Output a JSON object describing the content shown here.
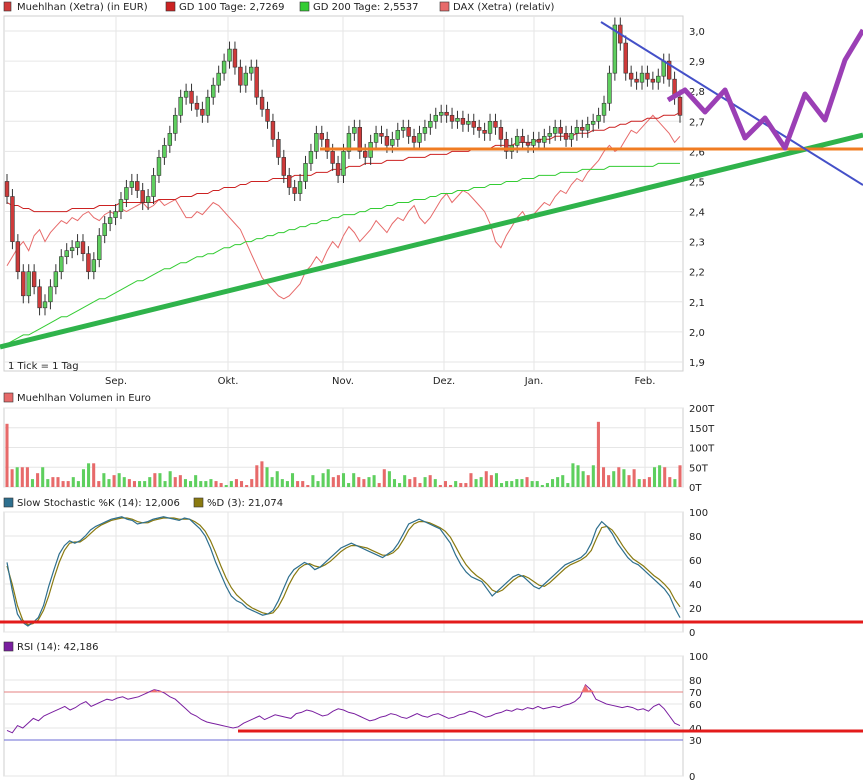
{
  "colors": {
    "up": "#5ecf5e",
    "down": "#cf3a3a",
    "gd100": "#cc2222",
    "gd200": "#33cc33",
    "dax": "#e76a6a",
    "stoch_k": "#2e6f8e",
    "stoch_d": "#8a7a10",
    "rsi": "#7a1fa0",
    "trend_green": "#2fb34b",
    "trend_blue": "#4450c8",
    "support_orange": "#f07c22",
    "purple_path": "#9b3fb5",
    "red_line": "#e31b1b",
    "grid": "#e6e6e6"
  },
  "chart_data": [
    {
      "type": "candlestick",
      "panel": "price",
      "legend": [
        {
          "label": "Muehlhan (Xetra) (in EUR)",
          "icon": "candle-icon"
        },
        {
          "label": "GD 100 Tage: 2,7269",
          "icon": "gd100-swatch"
        },
        {
          "label": "GD 200 Tage: 2,5537",
          "icon": "gd200-swatch"
        },
        {
          "label": "DAX (Xetra) (relativ)",
          "icon": "dax-swatch"
        }
      ],
      "note": "1 Tick = 1 Tag",
      "x_labels": [
        "Sep.",
        "Okt.",
        "Nov.",
        "Dez.",
        "Jan.",
        "Feb."
      ],
      "y_ticks": [
        "1,9",
        "2,0",
        "2,1",
        "2,2",
        "2,3",
        "2,4",
        "2,5",
        "2,6",
        "2,7",
        "2,8",
        "2,9",
        "3,0"
      ],
      "ylim": [
        1.87,
        3.05
      ],
      "close": [
        2.45,
        2.3,
        2.2,
        2.12,
        2.2,
        2.15,
        2.08,
        2.1,
        2.15,
        2.2,
        2.25,
        2.27,
        2.28,
        2.3,
        2.26,
        2.2,
        2.24,
        2.32,
        2.36,
        2.38,
        2.4,
        2.44,
        2.48,
        2.5,
        2.47,
        2.43,
        2.45,
        2.52,
        2.58,
        2.62,
        2.66,
        2.72,
        2.78,
        2.8,
        2.76,
        2.74,
        2.72,
        2.78,
        2.82,
        2.86,
        2.9,
        2.94,
        2.88,
        2.82,
        2.86,
        2.88,
        2.78,
        2.74,
        2.7,
        2.64,
        2.58,
        2.52,
        2.48,
        2.46,
        2.5,
        2.56,
        2.6,
        2.66,
        2.64,
        2.6,
        2.56,
        2.52,
        2.6,
        2.66,
        2.68,
        2.6,
        2.58,
        2.63,
        2.66,
        2.65,
        2.62,
        2.64,
        2.67,
        2.68,
        2.65,
        2.63,
        2.66,
        2.68,
        2.7,
        2.72,
        2.73,
        2.72,
        2.7,
        2.71,
        2.69,
        2.7,
        2.68,
        2.67,
        2.66,
        2.7,
        2.68,
        2.64,
        2.6,
        2.62,
        2.65,
        2.63,
        2.62,
        2.64,
        2.63,
        2.65,
        2.66,
        2.68,
        2.66,
        2.64,
        2.66,
        2.68,
        2.67,
        2.69,
        2.7,
        2.72,
        2.76,
        2.86,
        3.02,
        2.96,
        2.86,
        2.84,
        2.83,
        2.86,
        2.84,
        2.83,
        2.85,
        2.9,
        2.84,
        2.78,
        2.72
      ],
      "gd100": [
        2.43,
        2.42,
        2.42,
        2.41,
        2.41,
        2.4,
        2.4,
        2.4,
        2.4,
        2.4,
        2.4,
        2.4,
        2.41,
        2.41,
        2.41,
        2.41,
        2.41,
        2.42,
        2.42,
        2.42,
        2.42,
        2.43,
        2.43,
        2.43,
        2.43,
        2.43,
        2.43,
        2.43,
        2.44,
        2.44,
        2.44,
        2.44,
        2.45,
        2.45,
        2.45,
        2.46,
        2.46,
        2.46,
        2.47,
        2.47,
        2.48,
        2.48,
        2.48,
        2.49,
        2.49,
        2.5,
        2.5,
        2.5,
        2.5,
        2.51,
        2.51,
        2.51,
        2.51,
        2.52,
        2.52,
        2.52,
        2.52,
        2.53,
        2.53,
        2.53,
        2.54,
        2.54,
        2.54,
        2.55,
        2.55,
        2.55,
        2.56,
        2.56,
        2.56,
        2.56,
        2.57,
        2.57,
        2.57,
        2.57,
        2.58,
        2.58,
        2.58,
        2.58,
        2.59,
        2.59,
        2.59,
        2.59,
        2.6,
        2.6,
        2.6,
        2.6,
        2.61,
        2.61,
        2.61,
        2.61,
        2.62,
        2.62,
        2.62,
        2.62,
        2.63,
        2.63,
        2.63,
        2.63,
        2.64,
        2.64,
        2.64,
        2.65,
        2.65,
        2.65,
        2.65,
        2.66,
        2.66,
        2.66,
        2.67,
        2.67,
        2.67,
        2.68,
        2.68,
        2.69,
        2.69,
        2.7,
        2.7,
        2.7,
        2.71,
        2.71,
        2.71,
        2.72,
        2.72,
        2.72,
        2.73
      ],
      "gd200": [
        1.96,
        1.97,
        1.98,
        1.99,
        1.99,
        2.0,
        2.01,
        2.02,
        2.03,
        2.04,
        2.05,
        2.05,
        2.06,
        2.07,
        2.08,
        2.09,
        2.1,
        2.11,
        2.11,
        2.12,
        2.13,
        2.14,
        2.15,
        2.16,
        2.17,
        2.17,
        2.18,
        2.19,
        2.2,
        2.21,
        2.21,
        2.22,
        2.23,
        2.23,
        2.24,
        2.25,
        2.25,
        2.26,
        2.26,
        2.27,
        2.28,
        2.28,
        2.29,
        2.29,
        2.3,
        2.3,
        2.31,
        2.31,
        2.32,
        2.32,
        2.33,
        2.33,
        2.34,
        2.34,
        2.35,
        2.35,
        2.36,
        2.36,
        2.37,
        2.37,
        2.38,
        2.38,
        2.39,
        2.39,
        2.39,
        2.4,
        2.4,
        2.41,
        2.41,
        2.41,
        2.42,
        2.42,
        2.43,
        2.43,
        2.43,
        2.44,
        2.44,
        2.44,
        2.45,
        2.45,
        2.46,
        2.46,
        2.46,
        2.47,
        2.47,
        2.47,
        2.48,
        2.48,
        2.48,
        2.49,
        2.49,
        2.49,
        2.5,
        2.5,
        2.5,
        2.51,
        2.51,
        2.51,
        2.52,
        2.52,
        2.52,
        2.52,
        2.53,
        2.53,
        2.53,
        2.53,
        2.54,
        2.54,
        2.54,
        2.54,
        2.54,
        2.55,
        2.55,
        2.55,
        2.55,
        2.55,
        2.55,
        2.55,
        2.55,
        2.55,
        2.56,
        2.56,
        2.56,
        2.56,
        2.56
      ],
      "dax": [
        2.22,
        2.25,
        2.28,
        2.3,
        2.27,
        2.32,
        2.34,
        2.3,
        2.33,
        2.35,
        2.37,
        2.36,
        2.38,
        2.37,
        2.39,
        2.4,
        2.38,
        2.37,
        2.39,
        2.4,
        2.39,
        2.41,
        2.4,
        2.41,
        2.42,
        2.43,
        2.41,
        2.42,
        2.44,
        2.42,
        2.43,
        2.44,
        2.41,
        2.38,
        2.38,
        2.4,
        2.39,
        2.41,
        2.43,
        2.42,
        2.4,
        2.38,
        2.36,
        2.34,
        2.3,
        2.26,
        2.22,
        2.18,
        2.16,
        2.14,
        2.12,
        2.11,
        2.12,
        2.14,
        2.16,
        2.2,
        2.22,
        2.25,
        2.23,
        2.27,
        2.3,
        2.28,
        2.32,
        2.35,
        2.33,
        2.3,
        2.32,
        2.34,
        2.37,
        2.35,
        2.33,
        2.36,
        2.38,
        2.37,
        2.4,
        2.42,
        2.38,
        2.36,
        2.38,
        2.41,
        2.44,
        2.46,
        2.43,
        2.45,
        2.47,
        2.46,
        2.44,
        2.42,
        2.4,
        2.36,
        2.3,
        2.28,
        2.32,
        2.35,
        2.38,
        2.4,
        2.37,
        2.39,
        2.41,
        2.43,
        2.42,
        2.45,
        2.47,
        2.46,
        2.49,
        2.51,
        2.5,
        2.53,
        2.55,
        2.57,
        2.6,
        2.62,
        2.6,
        2.61,
        2.64,
        2.67,
        2.66,
        2.68,
        2.7,
        2.72,
        2.7,
        2.68,
        2.66,
        2.63,
        2.65
      ]
    },
    {
      "type": "bar",
      "panel": "volume",
      "legend": [
        {
          "label": "Muehlhan Volumen in Euro",
          "icon": "volume-swatch"
        }
      ],
      "y_ticks": [
        "0T",
        "50T",
        "100T",
        "150T",
        "200T"
      ],
      "ylim": [
        0,
        200
      ],
      "values": [
        160,
        45,
        50,
        50,
        50,
        20,
        35,
        50,
        20,
        25,
        25,
        15,
        15,
        25,
        15,
        45,
        60,
        60,
        15,
        35,
        20,
        30,
        35,
        25,
        20,
        15,
        15,
        15,
        25,
        35,
        35,
        15,
        40,
        25,
        30,
        20,
        15,
        30,
        15,
        15,
        20,
        15,
        10,
        5,
        15,
        20,
        15,
        5,
        20,
        55,
        65,
        50,
        25,
        40,
        20,
        15,
        35,
        15,
        15,
        5,
        30,
        15,
        35,
        45,
        25,
        30,
        35,
        10,
        35,
        25,
        20,
        25,
        30,
        10,
        45,
        40,
        20,
        10,
        30,
        20,
        25,
        10,
        25,
        30,
        20,
        5,
        15,
        5,
        15,
        10,
        10,
        35,
        20,
        25,
        40,
        30,
        35,
        10,
        15,
        15,
        20,
        20,
        25,
        15,
        15,
        5,
        10,
        20,
        25,
        30,
        10,
        60,
        55,
        40,
        30,
        55,
        165,
        50,
        30,
        40,
        50,
        45,
        30,
        45,
        20,
        20,
        25,
        50,
        55,
        50,
        25,
        20,
        55
      ],
      "up_flags": [
        0,
        0,
        1,
        0,
        0,
        1,
        0,
        1,
        1,
        0,
        0,
        0,
        0,
        1,
        1,
        1,
        1,
        0,
        0,
        1,
        1,
        0,
        1,
        1,
        0,
        0,
        1,
        1,
        1,
        0,
        1,
        1,
        1,
        0,
        0,
        1,
        1,
        1,
        1,
        1,
        1,
        0,
        0,
        1,
        1,
        0,
        0,
        0,
        0,
        0,
        0,
        1,
        1,
        1,
        1,
        1,
        1,
        0,
        0,
        0,
        1,
        1,
        1,
        1,
        0,
        0,
        1,
        1,
        1,
        0,
        0,
        1,
        1,
        0,
        0,
        1,
        1,
        1,
        1,
        0,
        0,
        0,
        1,
        0,
        1,
        0,
        0,
        0,
        1,
        0,
        0,
        0,
        1,
        1,
        0,
        0,
        1,
        1,
        1,
        1,
        1,
        1,
        0,
        1,
        1,
        1,
        1,
        1,
        1,
        1,
        1,
        1,
        1,
        1,
        0,
        1,
        0,
        0,
        0,
        1,
        0,
        1,
        0,
        0,
        1,
        0,
        0,
        1,
        1,
        0,
        0,
        1,
        0
      ]
    },
    {
      "type": "line",
      "panel": "stochastic",
      "legend": [
        {
          "label": "Slow Stochastic %K (14): 12,006",
          "icon": "stoch-k-swatch"
        },
        {
          "label": "%D (3): 21,074",
          "icon": "stoch-d-swatch"
        }
      ],
      "y_ticks": [
        "0",
        "20",
        "40",
        "60",
        "80",
        "100"
      ],
      "ylim": [
        0,
        100
      ],
      "k": [
        58,
        35,
        15,
        8,
        5,
        8,
        12,
        22,
        38,
        52,
        65,
        72,
        76,
        74,
        76,
        80,
        85,
        88,
        90,
        92,
        94,
        95,
        96,
        94,
        93,
        90,
        91,
        92,
        94,
        95,
        96,
        95,
        94,
        93,
        95,
        94,
        90,
        86,
        80,
        70,
        58,
        48,
        38,
        30,
        26,
        24,
        20,
        18,
        16,
        14,
        15,
        18,
        26,
        36,
        46,
        52,
        55,
        58,
        56,
        52,
        54,
        58,
        62,
        66,
        70,
        72,
        74,
        72,
        70,
        68,
        66,
        64,
        62,
        65,
        68,
        74,
        82,
        90,
        92,
        94,
        92,
        90,
        88,
        86,
        80,
        74,
        64,
        56,
        50,
        46,
        44,
        42,
        36,
        30,
        34,
        38,
        42,
        46,
        48,
        46,
        42,
        38,
        36,
        40,
        44,
        48,
        52,
        56,
        58,
        60,
        62,
        66,
        74,
        86,
        92,
        88,
        82,
        74,
        68,
        62,
        58,
        56,
        52,
        48,
        44,
        40,
        36,
        30,
        20,
        12
      ],
      "d": [
        55,
        40,
        22,
        10,
        6,
        7,
        10,
        18,
        30,
        45,
        58,
        68,
        74,
        75,
        75,
        78,
        82,
        86,
        89,
        91,
        93,
        94,
        95,
        95,
        94,
        92,
        91,
        91,
        93,
        94,
        95,
        95,
        95,
        94,
        94,
        94,
        92,
        89,
        84,
        76,
        66,
        55,
        45,
        37,
        31,
        27,
        23,
        20,
        18,
        16,
        15,
        16,
        21,
        29,
        39,
        47,
        53,
        56,
        57,
        55,
        54,
        56,
        59,
        63,
        67,
        70,
        72,
        72,
        71,
        70,
        68,
        66,
        64,
        64,
        66,
        70,
        77,
        85,
        90,
        92,
        92,
        91,
        89,
        87,
        84,
        79,
        71,
        63,
        56,
        51,
        47,
        44,
        40,
        35,
        33,
        35,
        39,
        43,
        46,
        47,
        45,
        42,
        39,
        38,
        41,
        45,
        49,
        53,
        56,
        58,
        60,
        63,
        68,
        78,
        87,
        88,
        85,
        79,
        72,
        66,
        61,
        58,
        55,
        51,
        47,
        44,
        40,
        35,
        27,
        21
      ]
    },
    {
      "type": "line",
      "panel": "rsi",
      "legend": [
        {
          "label": "RSI (14): 42,186",
          "icon": "rsi-swatch"
        }
      ],
      "y_ticks": [
        "0",
        "30",
        "40",
        "60",
        "70",
        "80",
        "100"
      ],
      "ylim": [
        0,
        100
      ],
      "values": [
        38,
        36,
        42,
        40,
        44,
        48,
        46,
        50,
        52,
        54,
        56,
        58,
        55,
        57,
        60,
        62,
        58,
        60,
        62,
        64,
        63,
        65,
        66,
        64,
        65,
        66,
        68,
        70,
        72,
        71,
        69,
        66,
        64,
        60,
        56,
        52,
        50,
        47,
        45,
        44,
        43,
        42,
        41,
        40,
        41,
        44,
        46,
        48,
        50,
        47,
        49,
        51,
        50,
        49,
        48,
        52,
        53,
        55,
        54,
        52,
        50,
        51,
        54,
        56,
        55,
        53,
        52,
        50,
        48,
        46,
        47,
        49,
        50,
        52,
        51,
        49,
        48,
        50,
        52,
        50,
        49,
        51,
        52,
        50,
        48,
        49,
        51,
        52,
        54,
        53,
        51,
        49,
        50,
        52,
        53,
        55,
        54,
        56,
        55,
        57,
        56,
        58,
        56,
        57,
        58,
        57,
        59,
        60,
        62,
        66,
        76,
        72,
        64,
        62,
        60,
        59,
        58,
        57,
        58,
        57,
        55,
        56,
        54,
        58,
        60,
        56,
        50,
        44,
        42
      ],
      "hlines": [
        {
          "value": 70,
          "label": "70"
        },
        {
          "value": 30,
          "label": "30"
        }
      ]
    }
  ],
  "annotations": {
    "purple_path_points": [
      [
        668,
        100
      ],
      [
        685,
        90
      ],
      [
        705,
        112
      ],
      [
        725,
        90
      ],
      [
        745,
        138
      ],
      [
        765,
        118
      ],
      [
        785,
        148
      ],
      [
        805,
        94
      ],
      [
        825,
        120
      ],
      [
        845,
        60
      ],
      [
        863,
        30
      ]
    ]
  }
}
